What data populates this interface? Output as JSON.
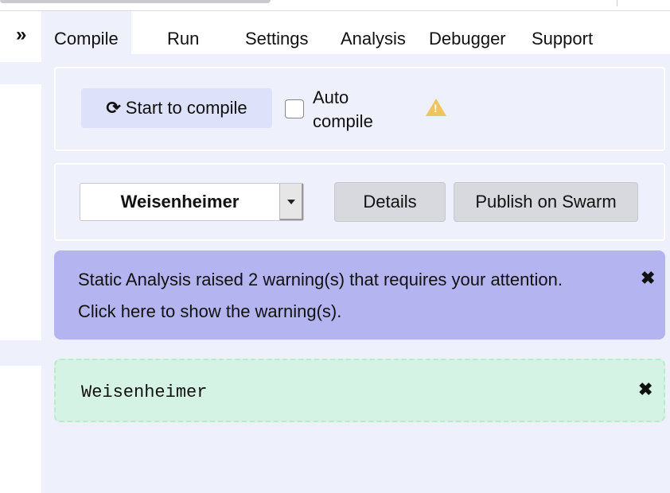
{
  "sidebar": {
    "collapse_glyph": "»",
    "collapse_icon": "double-chevron-right-icon"
  },
  "tabs": [
    {
      "label": "Compile",
      "active": true
    },
    {
      "label": "Run"
    },
    {
      "label": "Settings"
    },
    {
      "label": "Analysis"
    },
    {
      "label": "Debugger"
    },
    {
      "label": "Support"
    }
  ],
  "compile": {
    "button_label": "Start to compile",
    "button_icon": "refresh-icon",
    "button_glyph": "⟳",
    "auto_compile_label": "Auto compile",
    "auto_compile_checked": false,
    "warning_icon": "warning-triangle-icon"
  },
  "contract": {
    "selected": "Weisenheimer",
    "details_label": "Details",
    "publish_label": "Publish on Swarm"
  },
  "alerts": {
    "warning_line1": "Static Analysis raised 2 warning(s) that requires your attention.",
    "warning_line2": "Click here to show the warning(s).",
    "close_glyph": "✖",
    "success_text": "Weisenheimer"
  },
  "colors": {
    "panel_bg": "#eef0fb",
    "compile_btn_bg": "#dde1fa",
    "warning_alert_bg": "#b4b4f0",
    "success_alert_bg": "#d4f3e5",
    "warning_icon": "#f0c35b"
  }
}
